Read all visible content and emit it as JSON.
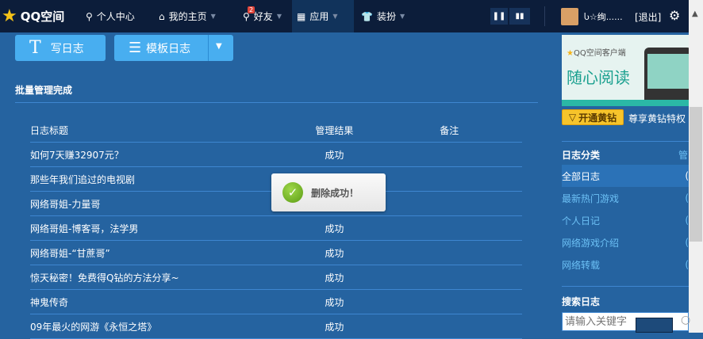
{
  "topbar": {
    "logo": "QQ空间",
    "nav": [
      {
        "label": "个人中心"
      },
      {
        "label": "我的主页"
      },
      {
        "label": "好友",
        "badge": "2"
      },
      {
        "label": "应用"
      },
      {
        "label": "装扮"
      }
    ],
    "username": "Ⴑ☆绚......",
    "logout": "[退出]"
  },
  "toolbar": {
    "write": "写日志",
    "template": "模板日志"
  },
  "main": {
    "title": "批量管理完成",
    "headers": [
      "日志标题",
      "管理结果",
      "备注"
    ],
    "rows": [
      {
        "title": "如何7天赚32907元？",
        "result": "成功"
      },
      {
        "title": "那些年我们追过的电视剧",
        "result": ""
      },
      {
        "title": "网络哥姐-力量哥",
        "result": ""
      },
      {
        "title": "网络哥姐-博客哥，法学男",
        "result": "成功"
      },
      {
        "title": "网络哥姐-“甘蔗哥”",
        "result": "成功"
      },
      {
        "title": "惊天秘密！免费得Q钻的方法分享~",
        "result": "成功"
      },
      {
        "title": "神鬼传奇",
        "result": "成功"
      },
      {
        "title": "09年最火的网游《永恒之塔》",
        "result": "成功"
      }
    ]
  },
  "toast": {
    "message": "删除成功！"
  },
  "sidebar": {
    "banner": {
      "brand": "QQ空间客户端",
      "slogan": "随心阅读"
    },
    "vip_button": "开通黄钻",
    "vip_text": "尊享黄钻特权",
    "category_title": "日志分类",
    "manage": "管",
    "categories": [
      {
        "label": "全部日志",
        "count": "("
      },
      {
        "label": "最新热门游戏",
        "count": "("
      },
      {
        "label": "个人日记",
        "count": "("
      },
      {
        "label": "网络游戏介绍",
        "count": "("
      },
      {
        "label": "网络转载",
        "count": "("
      }
    ],
    "search_title": "搜索日志",
    "search_placeholder": "请输入关键字"
  }
}
